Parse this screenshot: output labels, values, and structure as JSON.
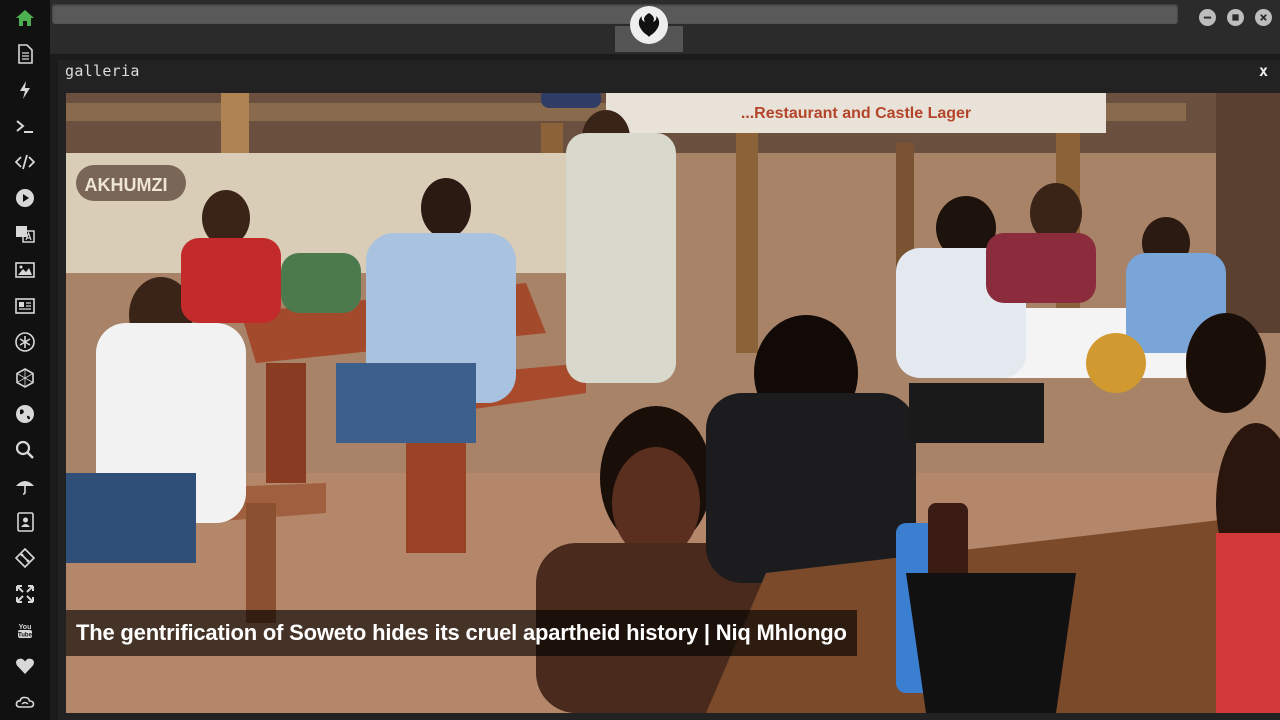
{
  "sidebar": {
    "items": [
      {
        "name": "home-icon",
        "active": true
      },
      {
        "name": "document-icon"
      },
      {
        "name": "lightning-icon"
      },
      {
        "name": "terminal-icon"
      },
      {
        "name": "code-icon"
      },
      {
        "name": "play-icon"
      },
      {
        "name": "translate-icon"
      },
      {
        "name": "image-icon"
      },
      {
        "name": "newspaper-icon"
      },
      {
        "name": "asterisk-icon"
      },
      {
        "name": "hexagon-icon"
      },
      {
        "name": "globe-icon"
      },
      {
        "name": "search-icon"
      },
      {
        "name": "umbrella-icon"
      },
      {
        "name": "contact-icon"
      },
      {
        "name": "git-icon"
      },
      {
        "name": "expand-icon"
      },
      {
        "name": "youtube-icon"
      },
      {
        "name": "heart-icon"
      },
      {
        "name": "cloud-icon"
      }
    ],
    "active_color": "#4caf50",
    "icon_color": "#d8d8d8"
  },
  "window": {
    "logo_icon": "rebel-alliance-icon",
    "controls": [
      "minimize-icon",
      "maximize-icon",
      "close-icon"
    ]
  },
  "panel": {
    "title": "galleria",
    "close_label": "x"
  },
  "gallery": {
    "caption": "The gentrification of Soweto hides its cruel apartheid history | Niq Mhlongo",
    "sign_text": "...Restaurant and Castle Lager",
    "left_sign_text": "AKHUMZI"
  }
}
